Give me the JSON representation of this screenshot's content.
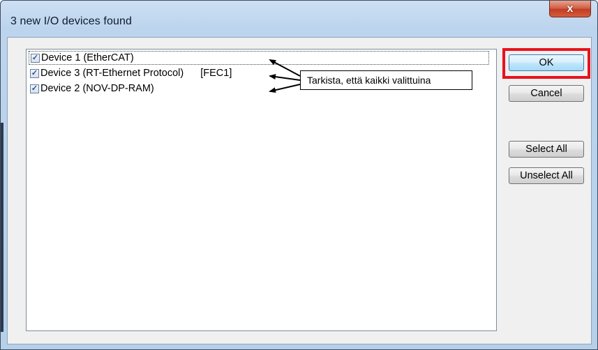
{
  "window": {
    "title": "3 new I/O devices found",
    "close_glyph": "x"
  },
  "device_list": {
    "items": [
      {
        "label": "Device 1 (EtherCAT)",
        "tag": "",
        "checked": true
      },
      {
        "label": "Device 3 (RT-Ethernet Protocol)",
        "tag": "[FEC1]",
        "checked": true
      },
      {
        "label": "Device 2 (NOV-DP-RAM)",
        "tag": "",
        "checked": true
      }
    ]
  },
  "annotation": {
    "text": "Tarkista, että kaikki valittuina",
    "highlight_color": "#e8121c"
  },
  "buttons": {
    "ok": "OK",
    "cancel": "Cancel",
    "select_all": "Select All",
    "unselect_all": "Unselect All"
  },
  "icons": {
    "close": "close-icon",
    "checkbox": "checkmark-icon"
  }
}
